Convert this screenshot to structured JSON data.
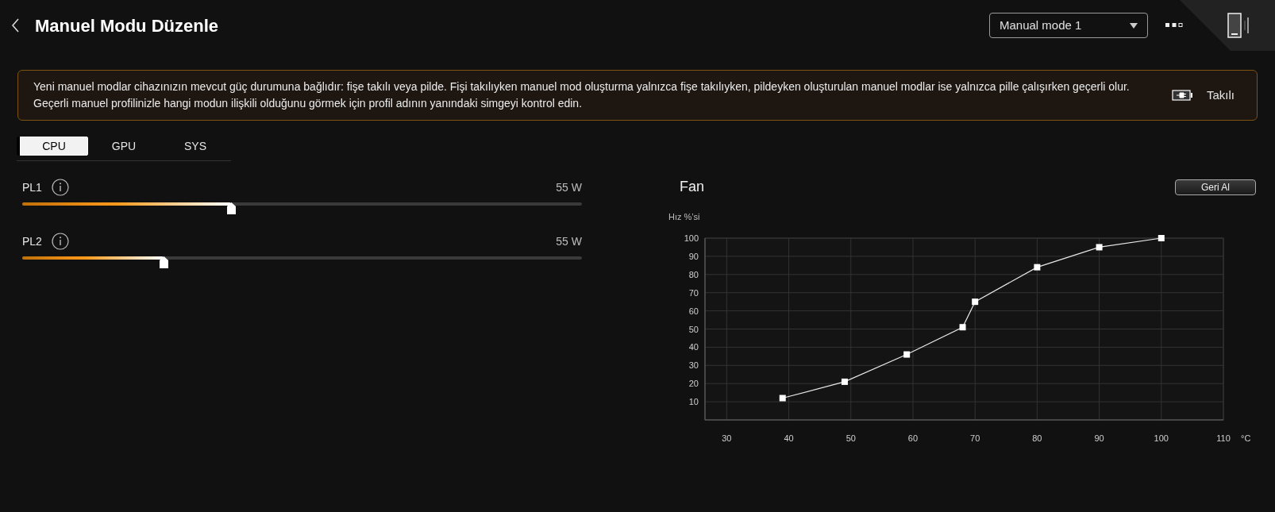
{
  "header": {
    "title": "Manuel Modu Düzenle",
    "mode_select": {
      "value": "Manual mode 1"
    }
  },
  "notice": {
    "paragraphs": [
      "Yeni manuel modlar cihazınızın mevcut güç durumuna bağlıdır: fişe takılı veya pilde. Fişi takılıyken manuel mod oluşturma yalnızca fişe takılıyken, pildeyken oluşturulan manuel modlar ise yalnızca pille çalışırken geçerli olur.",
      "Geçerli manuel profilinizle hangi modun ilişkili olduğunu görmek için profil adının yanındaki simgeyi kontrol edin."
    ],
    "power_state": "Takılı"
  },
  "tabs": [
    {
      "label": "CPU",
      "selected": true
    },
    {
      "label": "GPU",
      "selected": false
    },
    {
      "label": "SYS",
      "selected": false
    }
  ],
  "sliders": [
    {
      "name": "PL1",
      "reading": "55 W",
      "level": 0.373
    },
    {
      "name": "PL2",
      "reading": "55 W",
      "level": 0.252
    }
  ],
  "fan": {
    "title": "Fan",
    "reset_button": "Geri Al",
    "chart_data": {
      "type": "line",
      "ylabel": "Hız %’si",
      "xlabel": "°C",
      "x": [
        39,
        49,
        59,
        68,
        70,
        80,
        90,
        100
      ],
      "grid": true,
      "series": [
        {
          "color": "#e8e8e8",
          "marker": "square",
          "values": [
            12,
            21,
            36,
            51,
            65,
            84,
            95,
            100
          ]
        }
      ],
      "xlim": [
        26.5,
        110
      ],
      "ylim": [
        0,
        100
      ],
      "xticks": [
        30,
        40,
        50,
        60,
        70,
        80,
        90,
        100,
        110
      ],
      "yticks": [
        10,
        20,
        30,
        40,
        50,
        60,
        70,
        80,
        90,
        100
      ]
    }
  }
}
